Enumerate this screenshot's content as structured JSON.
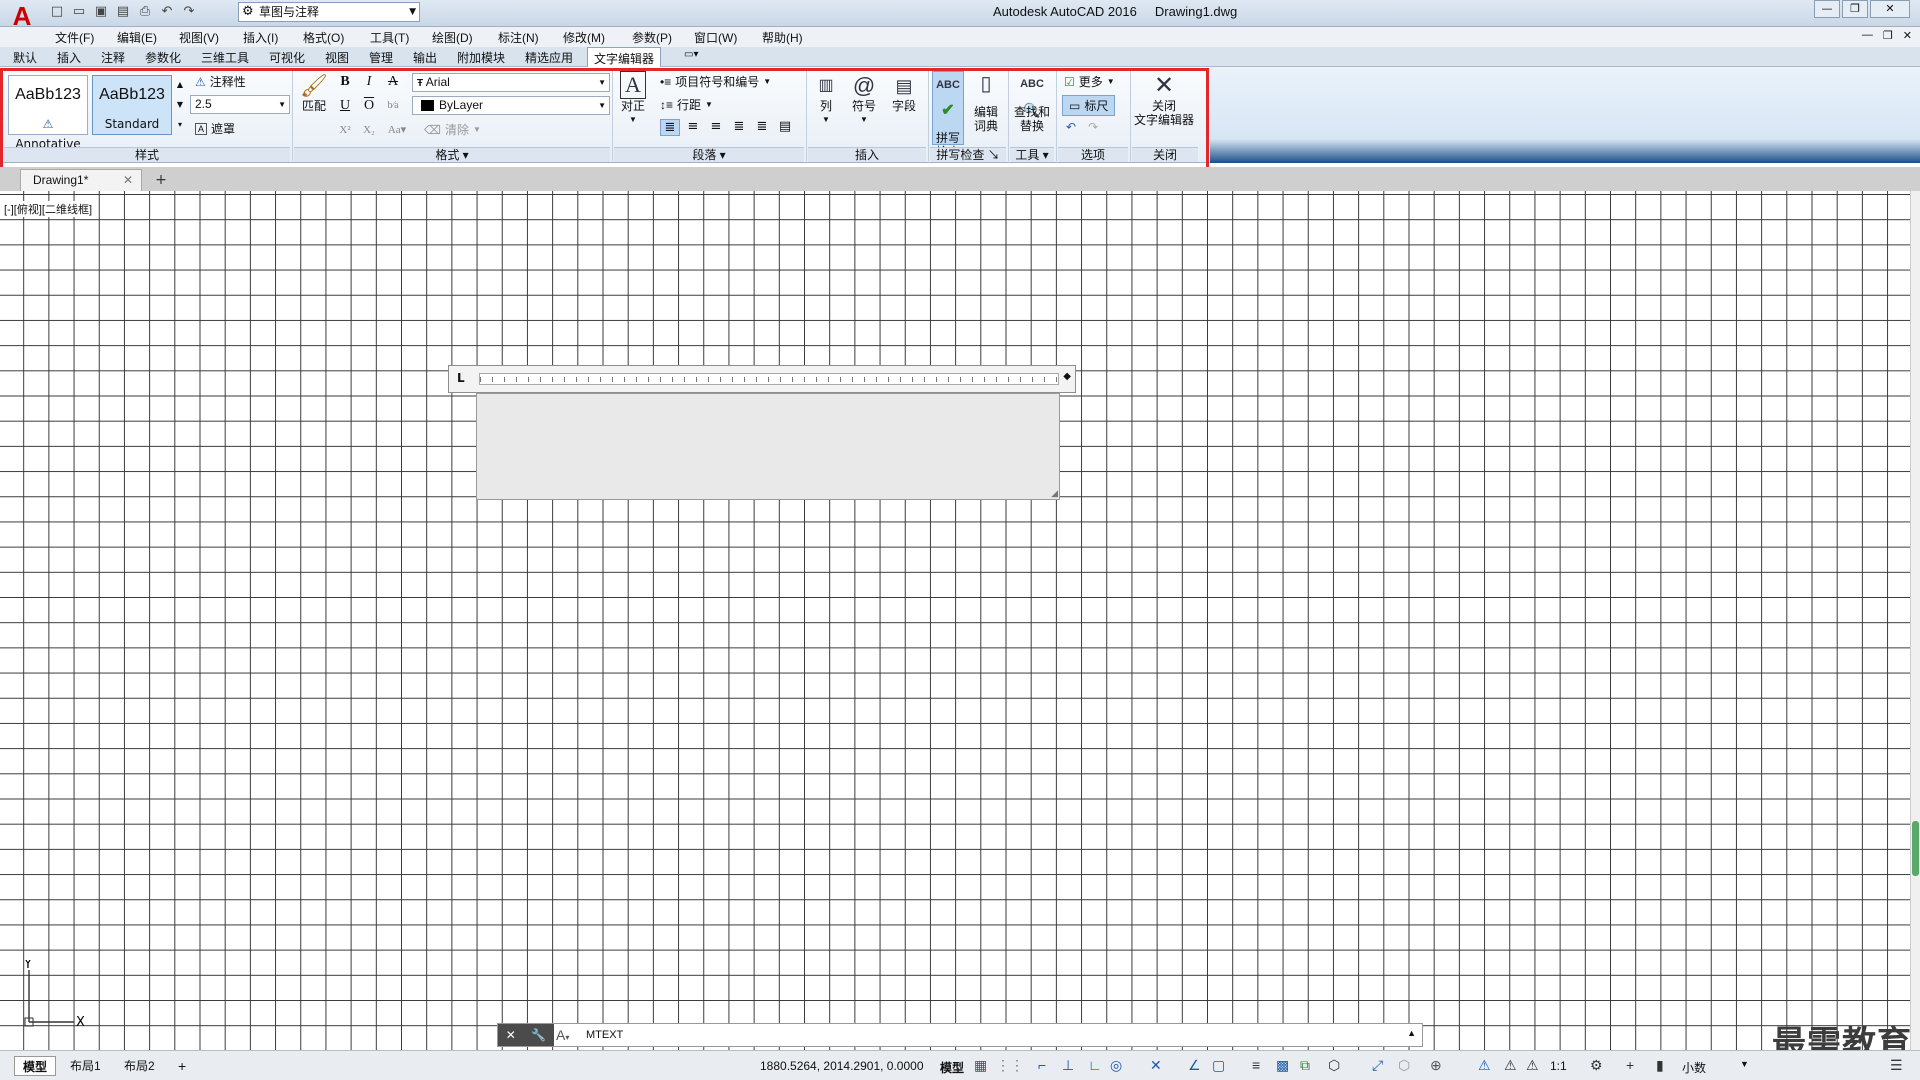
{
  "title_bar": {
    "app_name": "Autodesk AutoCAD 2016",
    "file_name": "Drawing1.dwg",
    "workspace": "草图与注释"
  },
  "menu": [
    "文件(F)",
    "编辑(E)",
    "视图(V)",
    "插入(I)",
    "格式(O)",
    "工具(T)",
    "绘图(D)",
    "标注(N)",
    "修改(M)",
    "参数(P)",
    "窗口(W)",
    "帮助(H)"
  ],
  "ribbon_tabs": [
    "默认",
    "插入",
    "注释",
    "参数化",
    "三维工具",
    "可视化",
    "视图",
    "管理",
    "输出",
    "附加模块",
    "精选应用",
    "文字编辑器"
  ],
  "active_ribbon_tab": "文字编辑器",
  "style_panel": {
    "label": "样式",
    "styles": [
      {
        "sample": "AaBb123",
        "name": "Annotative"
      },
      {
        "sample": "AaBb123",
        "name": "Standard"
      }
    ],
    "annotative": "注释性",
    "height_value": "2.5",
    "mask": "遮罩"
  },
  "format_panel": {
    "label": "格式",
    "match": "匹配",
    "font": "Arial",
    "color": "ByLayer",
    "clear": "清除",
    "bold": "B",
    "italic": "I",
    "underline": "U",
    "overline": "O"
  },
  "paragraph_panel": {
    "label": "段落",
    "justify": "对正",
    "bullets": "项目符号和编号",
    "line_spacing": "行距"
  },
  "insert_panel": {
    "label": "插入",
    "columns": "列",
    "symbol": "符号",
    "field": "字段"
  },
  "spell_panel": {
    "label": "拼写检查",
    "spell_check_1": "拼写",
    "spell_check_2": "检查",
    "edit_dict_1": "编辑",
    "edit_dict_2": "词典"
  },
  "tools_panel": {
    "label": "工具",
    "find_1": "查找和",
    "find_2": "替换"
  },
  "options_panel": {
    "label": "选项",
    "more": "更多",
    "ruler": "标尺"
  },
  "close_panel": {
    "label": "关闭",
    "close_1": "关闭",
    "close_2": "文字编辑器"
  },
  "doc_tab": "Drawing1*",
  "view_label": "[-][俯视][二维线框]",
  "ucs": {
    "y": "Y",
    "x": "X"
  },
  "command_line": "MTEXT",
  "layout_tabs": [
    "模型",
    "布局1",
    "布局2"
  ],
  "status": {
    "coords": "1880.5264, 2014.2901, 0.0000",
    "model": "模型",
    "scale": "1:1",
    "units": "小数"
  },
  "watermark": "最需教育"
}
